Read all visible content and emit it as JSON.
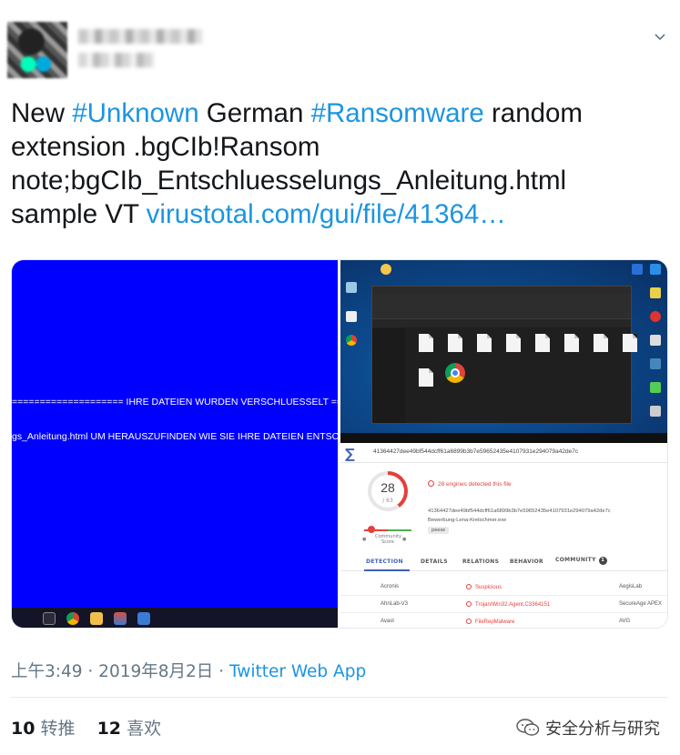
{
  "tweet": {
    "text_line1_a": "New ",
    "hashtag1": "#Unknown",
    "text_line1_b": " German ",
    "hashtag2": "#Ransomware",
    "text_line1_c": " random",
    "line2": "extension .bgCIb!Ransom",
    "line3": "note;bgCIb_Entschluesselungs_Anleitung.html",
    "line4_a": "sample VT ",
    "link": "virustotal.com/gui/file/41364…"
  },
  "media": {
    "left_banner_1": "==================== IHRE DATEIEN WURDEN VERSCHLUESSELT ====",
    "left_banner_2": "gs_Anleitung.html UM HERAUSZUFINDEN WIE SIE IHRE DATEIEN ENTSCHL",
    "vt": {
      "hash_bar": "41364427dee49bf544dcff61a6899b3b7e59652435e4107931e294079a42de7c",
      "score": "28",
      "score_total": "/ 63",
      "detected_text": "28 engines detected this file",
      "hash": "41364427dee49bf544dcff61a6899b3b7e59652435e4107931e294079a42de7c",
      "filename": "Bewerbung-Lena-Kretschmer.exe",
      "tag": "peexe",
      "community_label": "Community Score",
      "tabs": [
        "DETECTION",
        "DETAILS",
        "RELATIONS",
        "BEHAVIOR",
        "COMMUNITY"
      ],
      "community_count": "1",
      "rows": [
        {
          "engine": "Acronis",
          "result": "Suspicious",
          "engine2": "AegisLab"
        },
        {
          "engine": "AhnLab-V3",
          "result": "Trojan/Win32.Agent.C3364151",
          "engine2": "SecureAge APEX"
        },
        {
          "engine": "Avast",
          "result": "FileRepMalware",
          "engine2": "AVG"
        }
      ]
    }
  },
  "meta": {
    "time": "上午3:49 · 2019年8月2日 · ",
    "source": "Twitter Web App"
  },
  "stats": {
    "retweets_count": "10",
    "retweets_label": "转推",
    "likes_count": "12",
    "likes_label": "喜欢"
  },
  "watermark": "安全分析与研究",
  "icons": {
    "caret": "chevron-down-icon",
    "watermark": "wechat-icon"
  }
}
